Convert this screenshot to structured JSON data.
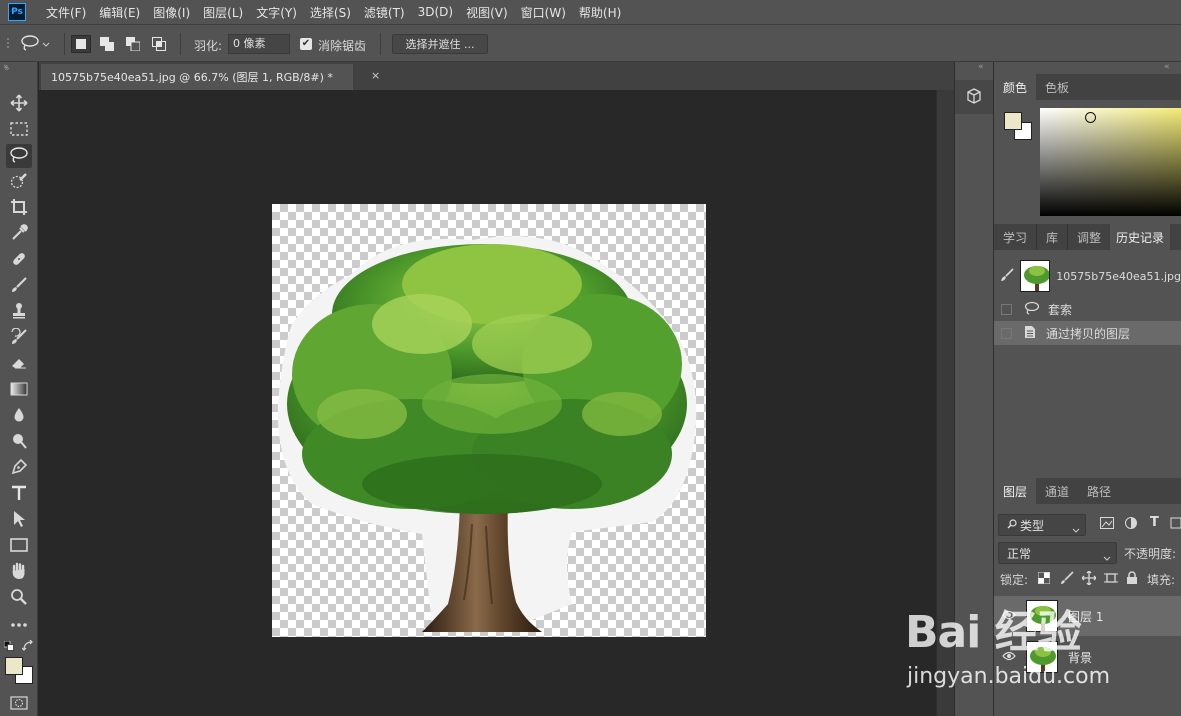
{
  "app": {
    "logo": "Ps"
  },
  "menu": [
    "文件(F)",
    "编辑(E)",
    "图像(I)",
    "图层(L)",
    "文字(Y)",
    "选择(S)",
    "滤镜(T)",
    "3D(D)",
    "视图(V)",
    "窗口(W)",
    "帮助(H)"
  ],
  "options": {
    "feather_label": "羽化:",
    "feather_value": "0 像素",
    "antialias_checked": true,
    "antialias_label": "消除锯齿",
    "select_mask_label": "选择并遮住 ..."
  },
  "document": {
    "tab_title": "10575b75e40ea51.jpg @ 66.7% (图层 1, RGB/8#) *",
    "close": "×"
  },
  "colors": {
    "foreground": "#ece8c7",
    "background": "#ffffff",
    "ui_bg": "#535353",
    "canvas_bg": "#282828"
  },
  "color_panel": {
    "tabs": [
      "颜色",
      "色板"
    ],
    "active": 0
  },
  "history_panel": {
    "tabs": [
      "学习",
      "库",
      "调整",
      "历史记录"
    ],
    "active": 3,
    "snapshot": "10575b75e40ea51.jpg",
    "states": [
      "套索",
      "通过拷贝的图层"
    ]
  },
  "layers_panel": {
    "tabs": [
      "图层",
      "通道",
      "路径"
    ],
    "active": 0,
    "filter_label": "类型",
    "blend_mode": "正常",
    "opacity_label": "不透明度:",
    "lock_label": "锁定:",
    "fill_label": "填充:",
    "layers": [
      {
        "name": "图层 1",
        "selected": true
      },
      {
        "name": "背景",
        "selected": false
      }
    ]
  },
  "watermark": {
    "logo": "Bai 经验",
    "url": "jingyan.baidu.com"
  },
  "icons": [
    "lasso-icon",
    "move-icon",
    "marquee-icon",
    "quick-select-icon",
    "crop-icon",
    "eyedropper-icon",
    "healing-brush-icon",
    "brush-icon",
    "stamp-icon",
    "history-brush-icon",
    "eraser-icon",
    "gradient-icon",
    "blur-icon",
    "dodge-icon",
    "pen-icon",
    "type-icon",
    "path-select-icon",
    "rectangle-icon",
    "hand-icon",
    "zoom-icon",
    "more-icon"
  ]
}
